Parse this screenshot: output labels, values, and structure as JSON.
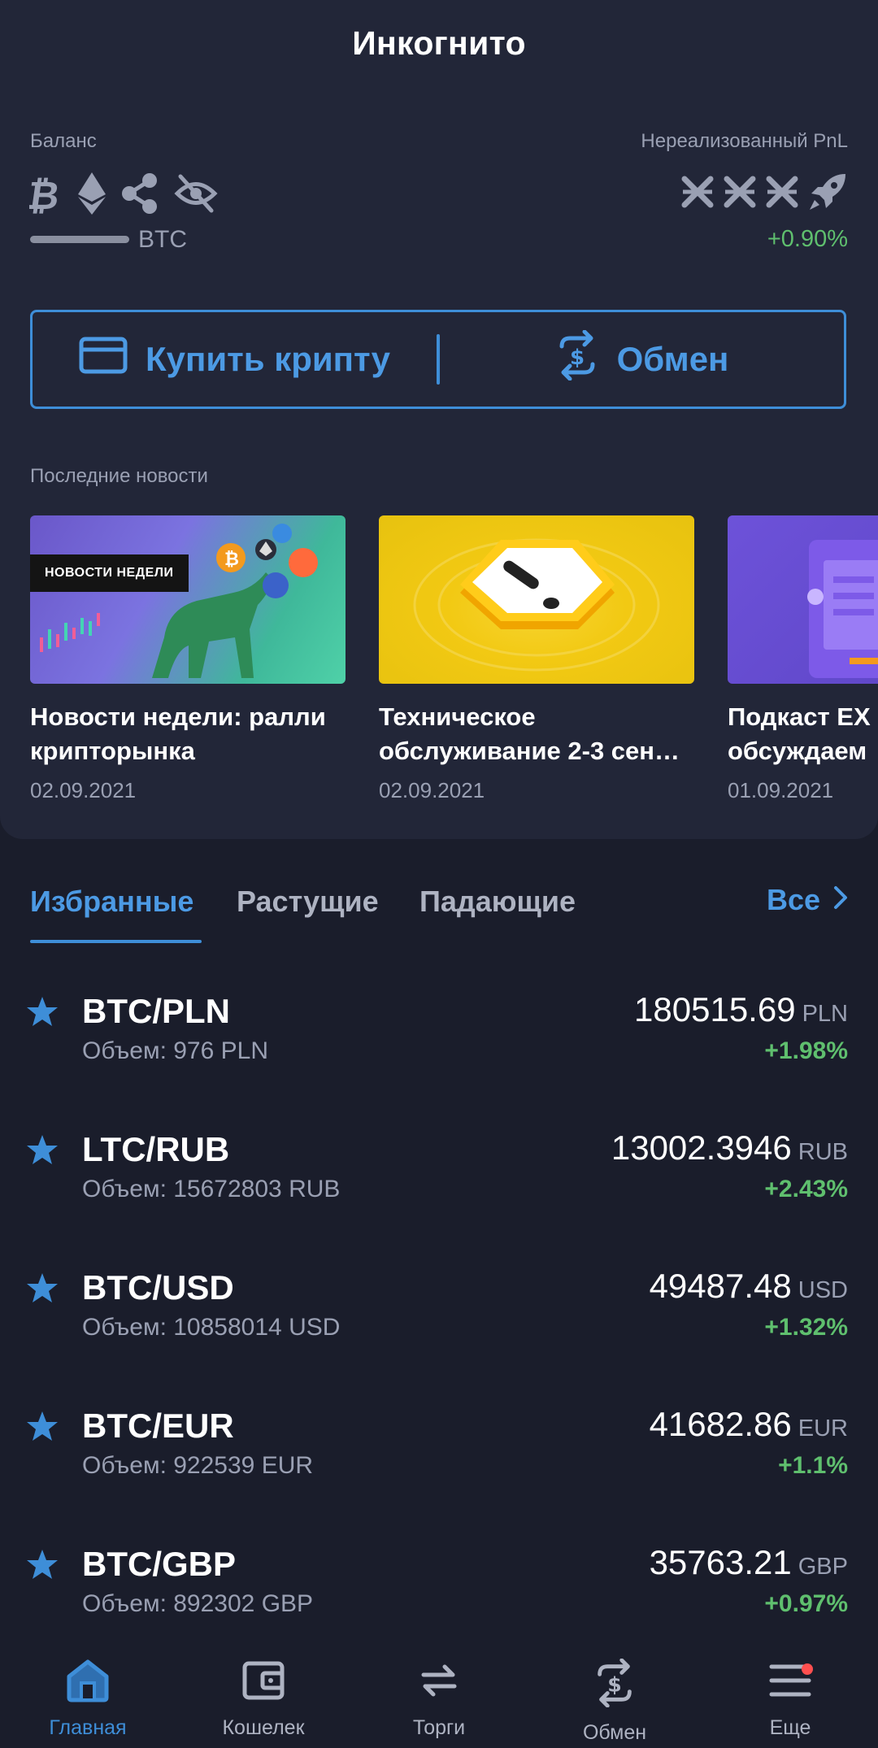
{
  "header": {
    "title": "Инкогнито"
  },
  "balance": {
    "label": "Баланс",
    "unit": "BTC",
    "pnl_label": "Нереализованный PnL",
    "pnl_value": "+0.90%",
    "coin_icons": [
      "bitcoin-icon",
      "ethereum-icon",
      "ripple-icon",
      "eye-off-icon"
    ]
  },
  "actions": {
    "buy_label": "Купить крипту",
    "exchange_label": "Обмен"
  },
  "news": {
    "section_label": "Последние новости",
    "items": [
      {
        "title": "Новости недели: ралли криптор­ынка",
        "title_line1": "Новости недели: ралли",
        "title_line2": "крипторынка",
        "date": "02.09.2021",
        "badge": "НОВОСТИ НЕДЕЛИ"
      },
      {
        "title_line1": "Техническое",
        "title_line2": "обслуживание 2-3 сен…",
        "date": "02.09.2021"
      },
      {
        "title_line1": "Подкаст EX",
        "title_line2": "обсуждаем",
        "date": "01.09.2021"
      }
    ]
  },
  "tabs": {
    "items": [
      "Избранные",
      "Растущие",
      "Падающие"
    ],
    "all_label": "Все"
  },
  "markets": [
    {
      "pair": "BTC/PLN",
      "volume": "Объем: 976 PLN",
      "price": "180515.69",
      "currency": "PLN",
      "change": "+1.98%"
    },
    {
      "pair": "LTC/RUB",
      "volume": "Объем: 15672803 RUB",
      "price": "13002.3946",
      "currency": "RUB",
      "change": "+2.43%"
    },
    {
      "pair": "BTC/USD",
      "volume": "Объем: 10858014 USD",
      "price": "49487.48",
      "currency": "USD",
      "change": "+1.32%"
    },
    {
      "pair": "BTC/EUR",
      "volume": "Объем: 922539 EUR",
      "price": "41682.86",
      "currency": "EUR",
      "change": "+1.1%"
    },
    {
      "pair": "BTC/GBP",
      "volume": "Объем: 892302 GBP",
      "price": "35763.21",
      "currency": "GBP",
      "change": "+0.97%"
    }
  ],
  "nav": {
    "items": [
      "Главная",
      "Кошелек",
      "Торги",
      "Обмен",
      "Еще"
    ]
  },
  "colors": {
    "accent": "#3e8ed8",
    "positive": "#5fbf6e",
    "background": "#1a1d2b",
    "card": "#222638",
    "notification": "#ff4f4f"
  }
}
